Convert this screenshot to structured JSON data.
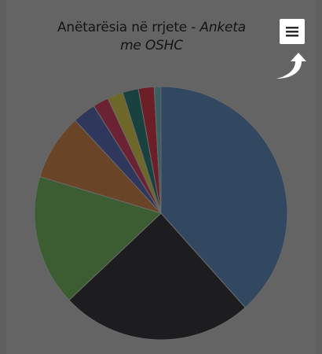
{
  "chart_title": {
    "main": "Anëtarësia në rrjete - ",
    "emphasis": "Anketa me OSHC"
  },
  "export_menu": {
    "icon": "hamburger-menu-icon",
    "hint_icon": "curved-arrow-up-icon"
  },
  "chart_data": {
    "type": "pie",
    "title": "Anëtarësia në rrjete - Anketa me OSHC",
    "legend": "none",
    "data_labels": "none",
    "slices": [
      {
        "value": 40.0,
        "color": "#324760"
      },
      {
        "value": 25.6,
        "color": "#1d1c1f"
      },
      {
        "value": 17.4,
        "color": "#3c5d32"
      },
      {
        "value": 8.8,
        "color": "#6a4427"
      },
      {
        "value": 3.1,
        "color": "#30375d"
      },
      {
        "value": 2.1,
        "color": "#6b2334"
      },
      {
        "value": 2.1,
        "color": "#6d6829"
      },
      {
        "value": 2.1,
        "color": "#184140"
      },
      {
        "value": 2.1,
        "color": "#6c1f27"
      },
      {
        "value": 0.9,
        "color": "#3a5e62"
      }
    ]
  }
}
